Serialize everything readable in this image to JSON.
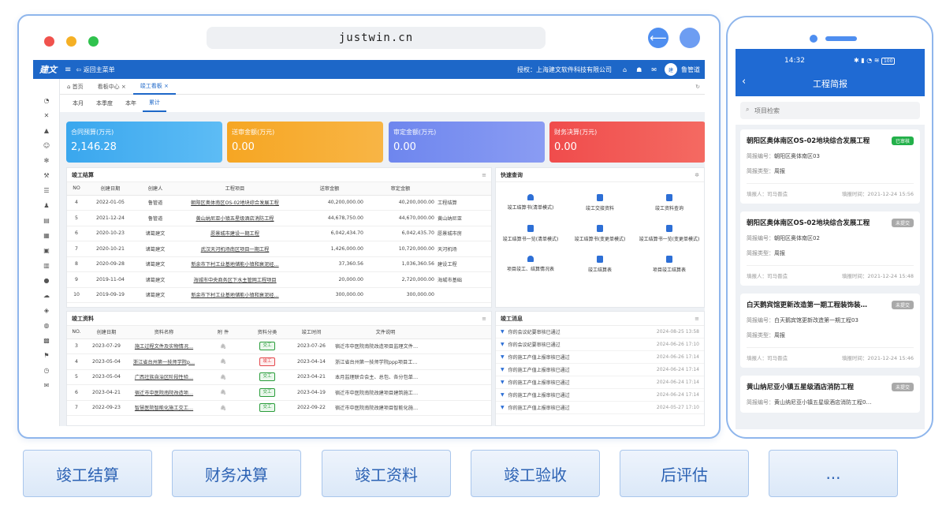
{
  "browser": {
    "url": "justwin.cn"
  },
  "app": {
    "logo": "建文",
    "back_label": "返回主菜单",
    "license": "授权：上海建文软件科技有限公司",
    "user": "鲁管道",
    "tabs": [
      {
        "label": "首页"
      },
      {
        "label": "看板中心"
      },
      {
        "label": "竣工看板"
      }
    ],
    "periods": [
      "本月",
      "本季度",
      "本年",
      "累计"
    ],
    "cards": [
      {
        "label": "合同预算(万元)",
        "value": "2,146.28",
        "color": "#3aa7ee"
      },
      {
        "label": "送审金额(万元)",
        "value": "0.00",
        "color": "#f6a623"
      },
      {
        "label": "审定金额(万元)",
        "value": "0.00",
        "color": "#6e86ee"
      },
      {
        "label": "财务决算(万元)",
        "value": "0.00",
        "color": "#f04c4c"
      }
    ],
    "settlement": {
      "title": "竣工结算",
      "columns": [
        "NO",
        "创建日期",
        "创建人",
        "工程项目",
        "送审金额",
        "审定金额",
        ""
      ],
      "rows": [
        {
          "no": "4",
          "date": "2022-01-05",
          "creator": "鲁管道",
          "project": "朝阳区奥体南区OS-02地块综合发展工程",
          "sub": "40,200,000.00",
          "app": "40,200,000.00",
          "note": "工程结算"
        },
        {
          "no": "5",
          "date": "2021-12-24",
          "creator": "鲁管道",
          "project": "黄山纳尼亚小镇五星级酒店消防工程",
          "sub": "44,678,750.00",
          "app": "44,670,000.00",
          "note": "黄山纳尼亚"
        },
        {
          "no": "6",
          "date": "2020-10-23",
          "creator": "诸葛建文",
          "project": "愿景城市建设一期工程",
          "sub": "6,042,434.70",
          "app": "6,042,435.70",
          "note": "愿景城市房"
        },
        {
          "no": "7",
          "date": "2020-10-21",
          "creator": "诸葛建文",
          "project": "武汉天河机场南区项目一期工程",
          "sub": "1,426,000.00",
          "app": "10,720,000.00",
          "note": "天河机场"
        },
        {
          "no": "8",
          "date": "2020-09-28",
          "creator": "诸葛建文",
          "project": "新余市下村工业基地储能小镇和衰泥经…",
          "sub": "37,360.56",
          "app": "1,036,360.56",
          "note": "建设工程"
        },
        {
          "no": "9",
          "date": "2019-11-04",
          "creator": "诸葛建文",
          "project": "海城市中央商务区下水主管网工程项目",
          "sub": "20,000.00",
          "app": "2,720,000.00",
          "note": "海城市基础"
        },
        {
          "no": "10",
          "date": "2019-09-19",
          "creator": "诸葛建文",
          "project": "新余市下村工业基地储能小镇和衰泥经…",
          "sub": "300,000.00",
          "app": "300,000.00",
          "note": ""
        }
      ]
    },
    "quick": {
      "title": "快速查询",
      "items": [
        "竣工结算书(清单模式)",
        "竣工交接资料",
        "竣工资料查询",
        "竣工结算书一览(清单模式)",
        "竣工结算书(变更单模式)",
        "竣工结算书一览(变更单模式)",
        "项目竣工、结算情况表",
        "竣工结算表",
        "项目竣工结算表"
      ]
    },
    "docs": {
      "title": "竣工资料",
      "columns": [
        "NO.",
        "创建日期",
        "资料名称",
        "附 件",
        "资料分类",
        "竣工时间",
        "文件说明",
        ""
      ],
      "rows": [
        {
          "no": "3",
          "date": "2023-07-29",
          "name": "施工过程文件及实物情况…",
          "cat": "交工",
          "red": false,
          "time": "2023-07-26",
          "desc": "宿迁市中医院南院改造项目监理文件…"
        },
        {
          "no": "4",
          "date": "2023-05-04",
          "name": "浙江省台州第一技师学院p…",
          "cat": "竣工",
          "red": true,
          "time": "2023-04-14",
          "desc": "浙江省台州第一技师学院ppp项目工…"
        },
        {
          "no": "5",
          "date": "2023-05-04",
          "name": "广西壮族自治区阶段性验…",
          "cat": "交工",
          "red": false,
          "time": "2023-04-21",
          "desc": "本月监理联合会主、总包、各分包单…"
        },
        {
          "no": "6",
          "date": "2023-04-21",
          "name": "宿迁市中医院南院改造项…",
          "cat": "交工",
          "red": false,
          "time": "2023-04-19",
          "desc": "宿迁市中医院南院改建项目建筑施工…"
        },
        {
          "no": "7",
          "date": "2022-09-23",
          "name": "智慧医院智能化施工交工…",
          "cat": "交工",
          "red": false,
          "time": "2022-09-22",
          "desc": "宿迁市中医院南院改建项目智能化施…"
        }
      ]
    },
    "messages": {
      "title": "竣工消息",
      "items": [
        {
          "text": "你的会议纪要审核已通过",
          "date": "2024-08-25 13:58"
        },
        {
          "text": "你的会议纪要审核已通过",
          "date": "2024-06-26 17:10"
        },
        {
          "text": "你的施工产值上报审核已通过",
          "date": "2024-06-26 17:14"
        },
        {
          "text": "你的施工产值上报审核已通过",
          "date": "2024-06-24 17:14"
        },
        {
          "text": "你的施工产值上报审核已通过",
          "date": "2024-06-24 17:14"
        },
        {
          "text": "你的施工产值上报审核已通过",
          "date": "2024-06-24 17:14"
        },
        {
          "text": "你的施工产值上报审核已通过",
          "date": "2024-05-27 17:10"
        }
      ]
    }
  },
  "phone": {
    "time": "14:32",
    "battery": "100",
    "title": "工程简报",
    "search_placeholder": "项目检索",
    "labels": {
      "code": "简报编号：",
      "type": "简报类型：",
      "reporter": "填报人：",
      "rdate": "填报时间："
    },
    "items": [
      {
        "title": "朝阳区奥体南区OS-02地块综合发展工程",
        "status": "已审核",
        "code": "朝阳区奥体南区03",
        "type": "周报",
        "reporter": "司马晋造",
        "date": "2021-12-24 15:56"
      },
      {
        "title": "朝阳区奥体南区OS-02地块综合发展工程",
        "status": "未提交",
        "code": "朝阳区奥体南区02",
        "type": "周报",
        "reporter": "司马晋造",
        "date": "2021-12-24 15:48"
      },
      {
        "title": "白天鹅宾馆更新改造第一期工程装饰装…",
        "status": "未提交",
        "code": "白天鹅宾馆更新改造第一期工程03",
        "type": "周报",
        "reporter": "司马晋造",
        "date": "2021-12-24 15:46"
      },
      {
        "title": "黄山纳尼亚小镇五星级酒店消防工程",
        "status": "未提交",
        "code": "黄山纳尼亚小镇五星级酒店消防工程0…",
        "type": "",
        "reporter": "",
        "date": ""
      }
    ]
  },
  "bottom_buttons": [
    "竣工结算",
    "财务决算",
    "竣工资料",
    "竣工验收",
    "后评估",
    "..."
  ]
}
